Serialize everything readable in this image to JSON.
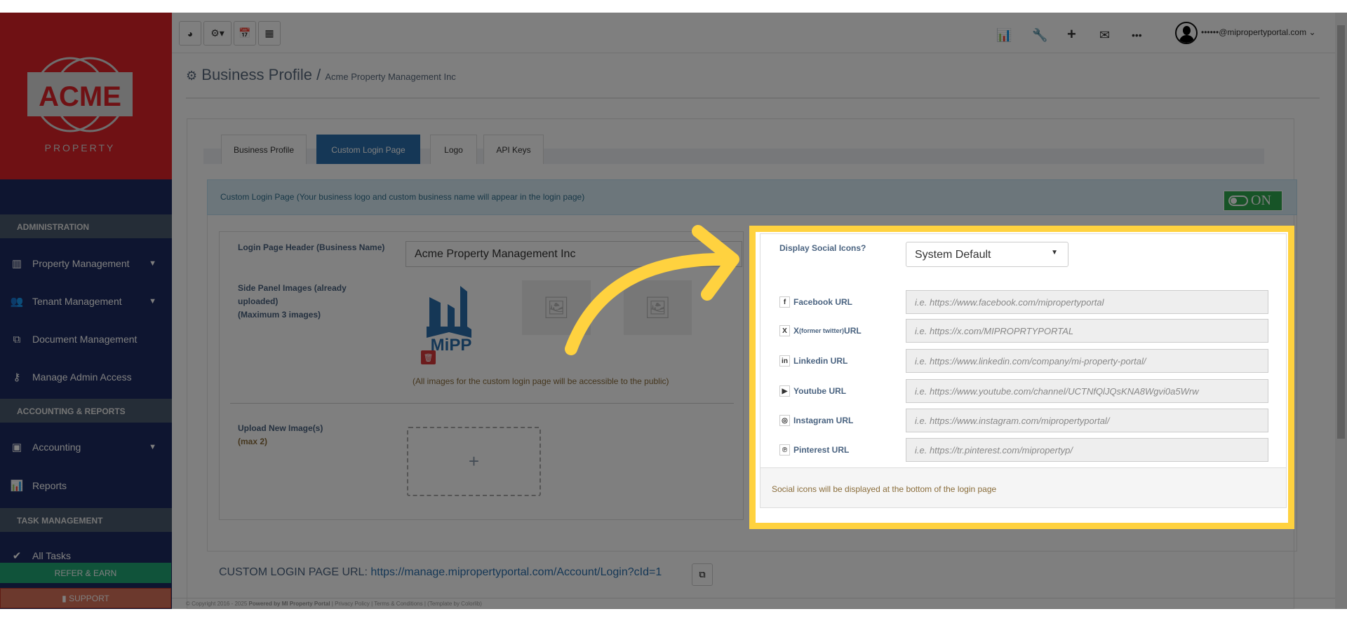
{
  "logo": {
    "brand": "ACME",
    "sub": "PROPERTY"
  },
  "sidebar": {
    "sections": [
      "ADMINISTRATION",
      "ACCOUNTING & REPORTS",
      "TASK MANAGEMENT"
    ],
    "items": [
      {
        "label": "Property Management",
        "icon": "building-icon"
      },
      {
        "label": "Tenant Management",
        "icon": "users-icon"
      },
      {
        "label": "Document Management",
        "icon": "documents-icon"
      },
      {
        "label": "Manage Admin Access",
        "icon": "key-icon"
      },
      {
        "label": "Accounting",
        "icon": "money-icon"
      },
      {
        "label": "Reports",
        "icon": "bar-chart-icon"
      },
      {
        "label": "All Tasks",
        "icon": "check-icon"
      }
    ],
    "refer": "REFER & EARN",
    "support": "SUPPORT"
  },
  "topbar": {
    "user_email": "••••••@mipropertyportal.com"
  },
  "header": {
    "title": "Business Profile",
    "separator": "/",
    "subtitle": "Acme Property Management Inc"
  },
  "tabs": [
    "Business Profile",
    "Custom Login Page",
    "Logo",
    "API Keys"
  ],
  "panel": {
    "title": "Custom Login Page (Your business logo and custom business name will appear in the login page)",
    "toggle": "ON",
    "header_label": "Login Page Header (Business Name)",
    "header_value": "Acme Property Management Inc",
    "images_label": [
      "Side Panel Images (already",
      "uploaded)",
      "(Maximum 3 images)"
    ],
    "mipp": "MiPP",
    "images_note": "(All images for the custom login page will be accessible to the public)",
    "upload_label": "Upload New Image(s)",
    "upload_max": "(max 2)",
    "upload_plus": "+",
    "url_label": "CUSTOM LOGIN PAGE URL:",
    "url": "https://manage.mipropertyportal.com/Account/Login?cId=1"
  },
  "social": {
    "display_label": "Display Social Icons?",
    "display_value": "System Default",
    "rows": [
      {
        "icon": "f",
        "label": "Facebook URL",
        "sub": "",
        "placeholder": "i.e. https://www.facebook.com/mipropertyportal"
      },
      {
        "icon": "X",
        "label": "X ",
        "sub": "(former twitter)",
        "label2": " URL",
        "placeholder": "i.e. https://x.com/MIPROPRTYPORTAL"
      },
      {
        "icon": "in",
        "label": "Linkedin URL",
        "sub": "",
        "placeholder": "i.e. https://www.linkedin.com/company/mi-property-portal/"
      },
      {
        "icon": "▶",
        "label": "Youtube URL",
        "sub": "",
        "placeholder": "i.e. https://www.youtube.com/channel/UCTNfQlJQsKNA8Wgvi0a5Wrw"
      },
      {
        "icon": "◎",
        "label": "Instagram URL",
        "sub": "",
        "placeholder": "i.e. https://www.instagram.com/mipropertyportal/"
      },
      {
        "icon": "℗",
        "label": "Pinterest URL",
        "sub": "",
        "placeholder": "i.e. https://tr.pinterest.com/mipropertyp/"
      }
    ],
    "footer": "Social icons will be displayed at the bottom of the login page"
  },
  "footer": {
    "copyright": "© Copyright 2016 - 2025",
    "powered": "Powered by MI Property Portal",
    "links": "| Privacy Policy | Terms & Conditions |",
    "template": "(Template by Colorlib)"
  },
  "colors": {
    "accent": "#2a6fad",
    "highlight": "#ffd23f",
    "sidebar": "#1d2b60",
    "brand": "#de2229"
  }
}
